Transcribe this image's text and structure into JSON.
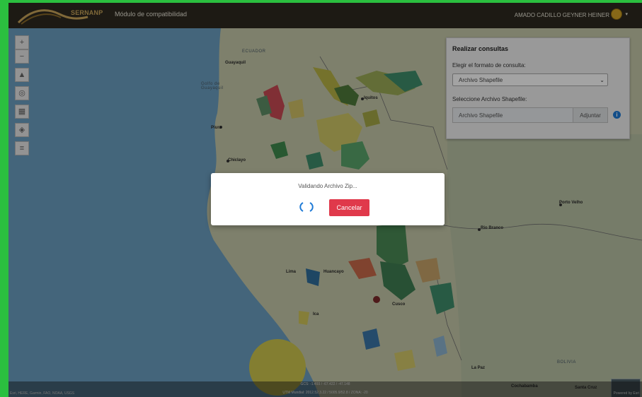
{
  "header": {
    "logo_text": "SERNANP",
    "module_title": "Módulo de compatibilidad",
    "user_name": "AMADO CADILLO GEYNER HEINER"
  },
  "map": {
    "labels": {
      "ecuador": "ECUADOR",
      "guayaquil": "Guayaquil",
      "gulf": "Golfo de Guayaquil",
      "iquitos": "Iquitos",
      "piura": "Piura",
      "chiclayo": "Chiclayo",
      "porto_velho": "Porto Velho",
      "rio_branco": "Rio Branco",
      "lima": "Lima",
      "huancayo": "Huancayo",
      "cusco": "Cusco",
      "ica": "Ica",
      "la_paz": "La Paz",
      "bolivia": "BOLIVIA",
      "cochabamba": "Cochabamba",
      "santa_cruz": "Santa Cruz"
    },
    "icons": [
      "zoom-in-icon",
      "zoom-out-icon",
      "compass-icon",
      "locate-icon",
      "grid-icon",
      "layers-icon",
      "menu-icon"
    ]
  },
  "query_panel": {
    "title": "Realizar consultas",
    "format_label": "Elegir el formato de consulta:",
    "format_value": "Archivo Shapefile",
    "file_label": "Seleccione Archivo Shapefile:",
    "file_value": "Archivo Shapefile",
    "attach_label": "Adjuntar",
    "info_icon": "i"
  },
  "modal": {
    "message": "Validando Archivo Zip...",
    "cancel_label": "Cancelar"
  },
  "footer": {
    "coords_geo": "GCS: -1.493 / -67.422 / -47.148",
    "coords_utm": "UTM Mundial: 2012.52.3.22 / 5005.9/52.8 / ZONA: -20",
    "attribution_left": "Esri, HERE, Garmin, FAO, NOAA, USGS",
    "attribution_right": "Powered by Esri"
  },
  "colors": {
    "accent_red": "#e0394b",
    "spinner_blue": "#1f7ad6",
    "header_bg": "#2e2a20"
  }
}
